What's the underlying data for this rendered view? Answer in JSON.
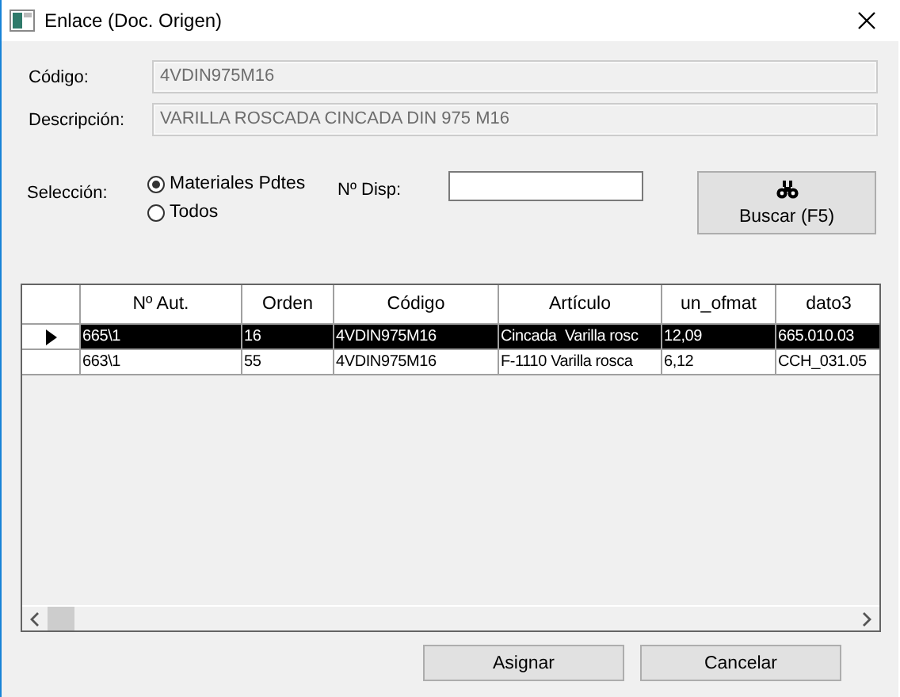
{
  "window": {
    "title": "Enlace (Doc. Origen)"
  },
  "fields": [
    {
      "label": "Código:",
      "value": "4VDIN975M16",
      "disabled": true
    },
    {
      "label": "Descripción:",
      "value": "VARILLA ROSCADA CINCADA DIN 975 M16",
      "disabled": true
    }
  ],
  "seleccion": {
    "label": "Selección:",
    "options": [
      {
        "label": "Materiales Pdtes",
        "selected": true
      },
      {
        "label": "Todos",
        "selected": false
      }
    ]
  },
  "disp": {
    "label": "Nº Disp:"
  },
  "search_button": {
    "label": "Buscar  (F5)"
  },
  "table": {
    "columns": [
      "Nº Aut.",
      "Orden",
      "Código",
      "Artículo",
      "un_ofmat",
      "dato3"
    ],
    "rows": [
      {
        "selected": true,
        "cells": [
          "665\\1",
          "16",
          "4VDIN975M16",
          "Cincada  Varilla rosc",
          "12,09",
          "665.010.03"
        ]
      },
      {
        "selected": false,
        "cells": [
          "663\\1",
          "55",
          "4VDIN975M16",
          "F-1110 Varilla rosca",
          "6,12",
          "CCH_031.05"
        ]
      }
    ]
  },
  "buttons": [
    "Asignar",
    "Cancelar"
  ]
}
